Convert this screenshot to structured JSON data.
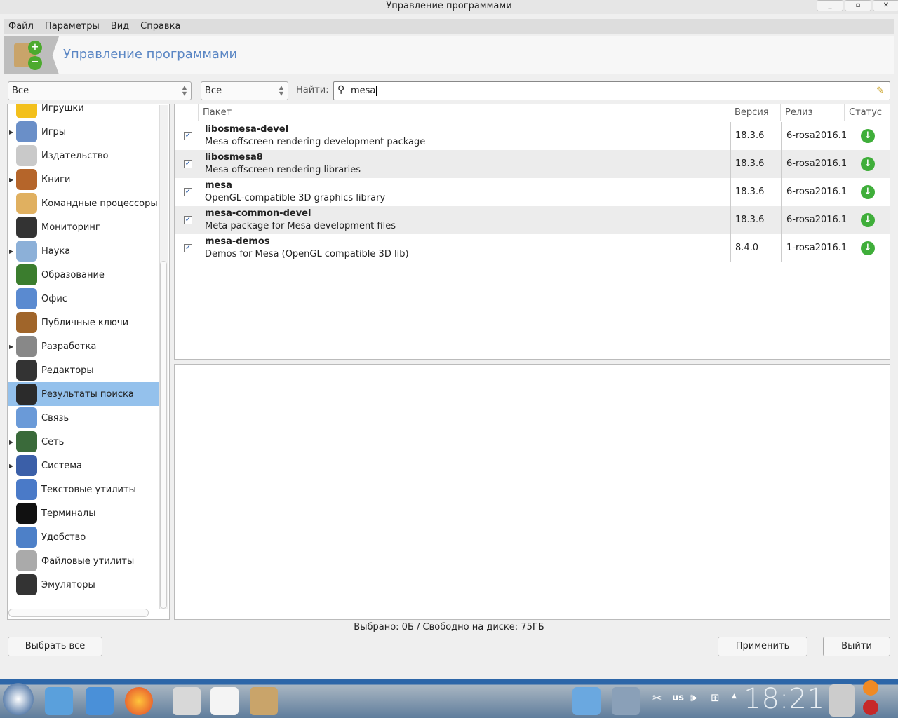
{
  "window": {
    "title": "Управление программами",
    "min": "_",
    "max": "▫",
    "close": "✕"
  },
  "menu": [
    "Файл",
    "Параметры",
    "Вид",
    "Справка"
  ],
  "banner": {
    "title": "Управление программами"
  },
  "filters": {
    "category": "Все",
    "status": "Все",
    "search_label": "Найти:",
    "search_value": "mesa"
  },
  "categories": [
    {
      "label": "Игрушки",
      "exp": false,
      "color": "#f3c01c"
    },
    {
      "label": "Игры",
      "exp": true,
      "color": "#6a8fc8"
    },
    {
      "label": "Издательство",
      "exp": false,
      "color": "#c9c9c9"
    },
    {
      "label": "Книги",
      "exp": true,
      "color": "#b5652a"
    },
    {
      "label": "Командные процессоры",
      "exp": false,
      "color": "#e0b060"
    },
    {
      "label": "Мониторинг",
      "exp": false,
      "color": "#333"
    },
    {
      "label": "Наука",
      "exp": true,
      "color": "#8cb0d8"
    },
    {
      "label": "Образование",
      "exp": false,
      "color": "#3b7d2e"
    },
    {
      "label": "Офис",
      "exp": false,
      "color": "#5a8ad0"
    },
    {
      "label": "Публичные ключи",
      "exp": false,
      "color": "#a0652a"
    },
    {
      "label": "Разработка",
      "exp": true,
      "color": "#888"
    },
    {
      "label": "Редакторы",
      "exp": false,
      "color": "#333"
    },
    {
      "label": "Результаты поиска",
      "exp": false,
      "color": "#2b2b2b",
      "selected": true
    },
    {
      "label": "Связь",
      "exp": false,
      "color": "#6a9ad8"
    },
    {
      "label": "Сеть",
      "exp": true,
      "color": "#3a6a3a"
    },
    {
      "label": "Система",
      "exp": true,
      "color": "#3b5fa8"
    },
    {
      "label": "Текстовые утилиты",
      "exp": false,
      "color": "#4a7ac8"
    },
    {
      "label": "Терминалы",
      "exp": false,
      "color": "#111"
    },
    {
      "label": "Удобство",
      "exp": false,
      "color": "#4d80c8"
    },
    {
      "label": "Файловые утилиты",
      "exp": false,
      "color": "#aaa"
    },
    {
      "label": "Эмуляторы",
      "exp": false,
      "color": "#333"
    }
  ],
  "table": {
    "headers": {
      "package": "Пакет",
      "version": "Версия",
      "release": "Релиз",
      "status": "Статус"
    },
    "rows": [
      {
        "name": "libosmesa-devel",
        "desc": "Mesa offscreen rendering development package",
        "version": "18.3.6",
        "release": "6-rosa2016.1"
      },
      {
        "name": "libosmesa8",
        "desc": "Mesa offscreen rendering libraries",
        "version": "18.3.6",
        "release": "6-rosa2016.1"
      },
      {
        "name": "mesa",
        "desc": "OpenGL-compatible 3D graphics library",
        "version": "18.3.6",
        "release": "6-rosa2016.1"
      },
      {
        "name": "mesa-common-devel",
        "desc": "Meta package for Mesa development files",
        "version": "18.3.6",
        "release": "6-rosa2016.1"
      },
      {
        "name": "mesa-demos",
        "desc": "Demos for Mesa (OpenGL compatible 3D lib)",
        "version": "8.4.0",
        "release": "1-rosa2016.1"
      }
    ]
  },
  "status": "Выбрано: 0Б / Свободно на диске: 75ГБ",
  "buttons": {
    "select_all": "Выбрать все",
    "apply": "Применить",
    "quit": "Выйти"
  },
  "taskbar": {
    "kbd": "us",
    "clock": "18:21"
  }
}
